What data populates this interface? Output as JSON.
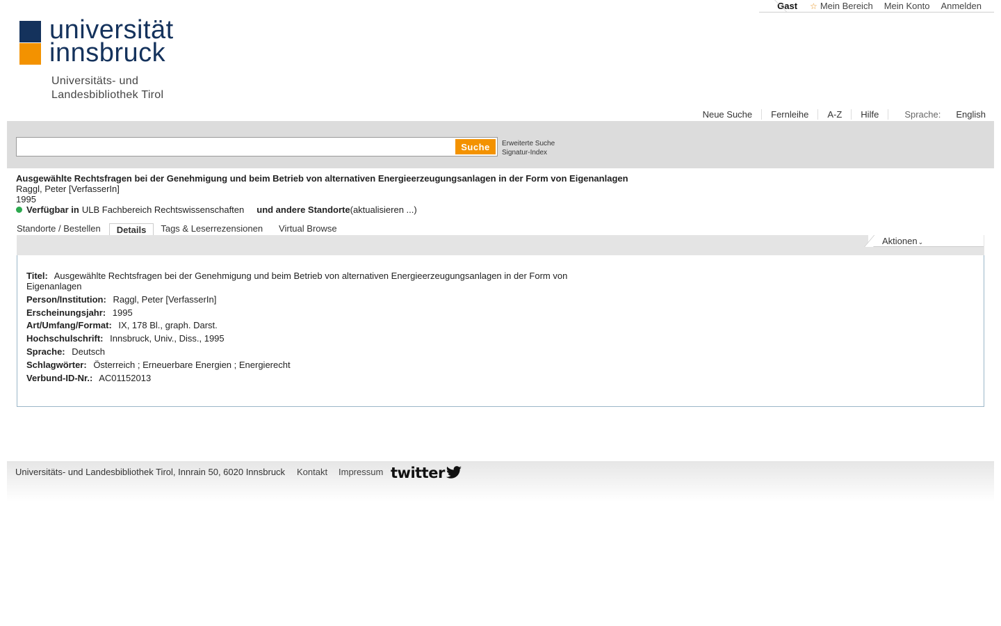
{
  "userbar": {
    "guest": "Gast",
    "items": [
      "Mein Bereich",
      "Mein Konto",
      "Anmelden"
    ]
  },
  "logo": {
    "line1": "universität",
    "line2": "innsbruck",
    "sub1": "Universitäts- und",
    "sub2": "Landesbibliothek Tirol",
    "colors": {
      "blue": "#14325c",
      "orange": "#f39200"
    }
  },
  "nav": {
    "items": [
      "Neue Suche",
      "Fernleihe",
      "A-Z",
      "Hilfe"
    ],
    "language_label": "Sprache:",
    "language": "English"
  },
  "search": {
    "value": "",
    "button": "Suche",
    "advanced": "Erweiterte Suche",
    "index": "Signatur-Index"
  },
  "record": {
    "title": "Ausgewählte Rechtsfragen bei der Genehmigung und beim Betrieb von alternativen Energieerzeugungsanlagen in der Form von Eigenanlagen",
    "author": "Raggl, Peter [VerfasserIn]",
    "year": "1995",
    "availability": {
      "label": "Verfügbar in",
      "location": "ULB Fachbereich Rechtswissenschaften",
      "others": "und andere Standorte",
      "refresh": "(aktualisieren ...)",
      "status_color": "#2da94f"
    }
  },
  "tabs": [
    "Standorte / Bestellen",
    "Details",
    "Tags & Leserrezensionen",
    "Virtual Browse"
  ],
  "actions": "Aktionen",
  "details": [
    {
      "label": "Titel:",
      "value": "Ausgewählte Rechtsfragen bei der Genehmigung und beim Betrieb von alternativen Energieerzeugungsanlagen in der Form von Eigenanlagen"
    },
    {
      "label": "Person/Institution:",
      "value": "Raggl, Peter [VerfasserIn]"
    },
    {
      "label": "Erscheinungsjahr:",
      "value": "1995"
    },
    {
      "label": "Art/Umfang/Format:",
      "value": "IX, 178 Bl., graph. Darst."
    },
    {
      "label": "Hochschulschrift:",
      "value": "Innsbruck, Univ., Diss., 1995"
    },
    {
      "label": "Sprache:",
      "value": "Deutsch"
    },
    {
      "label": "Schlagwörter:",
      "value": "Österreich ; Erneuerbare Energien ; Energierecht"
    },
    {
      "label": "Verbund-ID-Nr.:",
      "value": "AC01152013"
    }
  ],
  "footer": {
    "address": "Universitäts- und Landesbibliothek Tirol, Innrain 50, 6020 Innsbruck",
    "contact": "Kontakt",
    "imprint": "Impressum",
    "twitter": "twitter"
  }
}
